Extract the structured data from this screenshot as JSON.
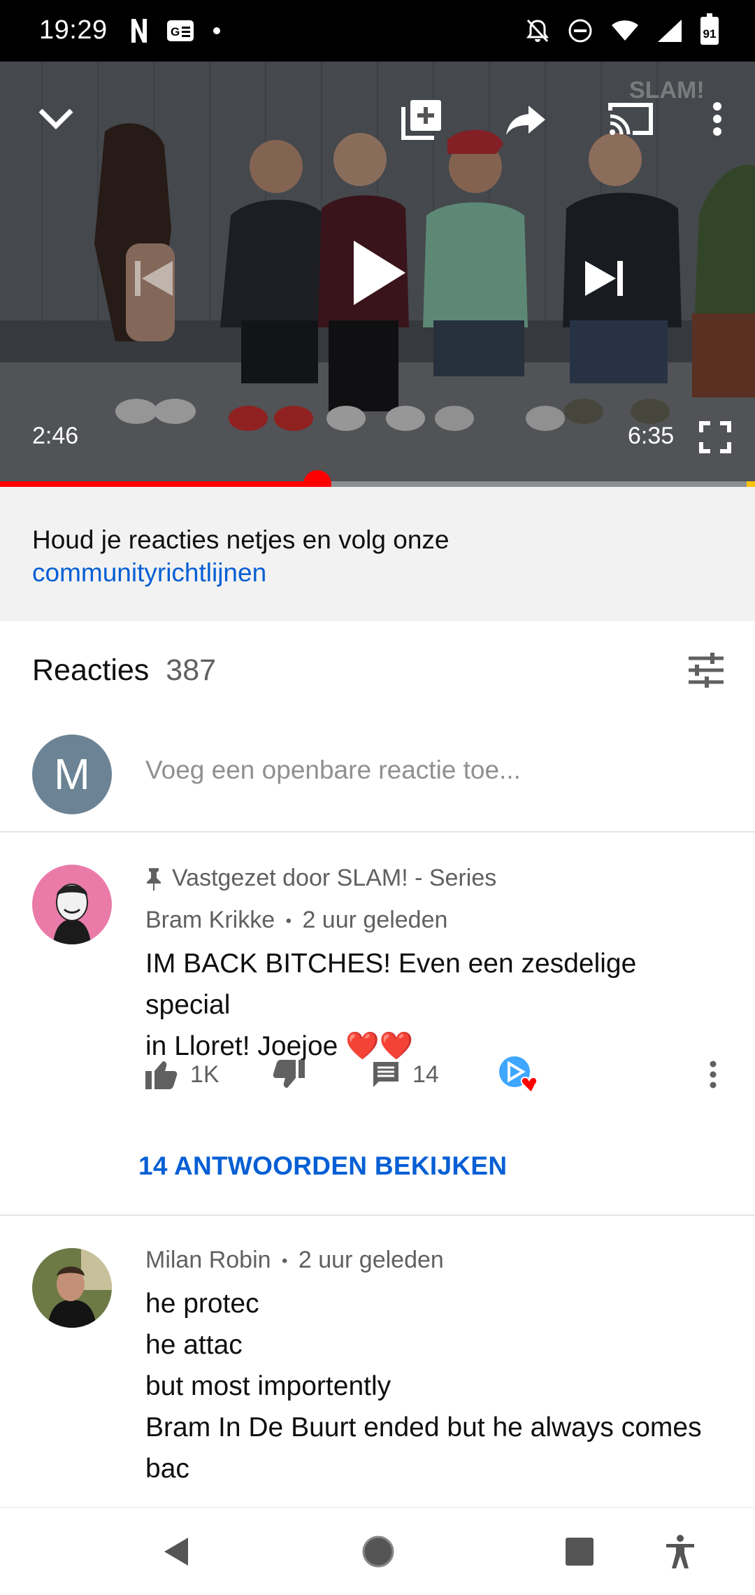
{
  "status_bar": {
    "time": "19:29",
    "battery": "91",
    "left_icons": [
      "netflix-icon",
      "news-icon",
      "dot-icon"
    ],
    "right_icons": [
      "bell-off-icon",
      "do-not-disturb-icon",
      "wifi-icon",
      "signal-icon",
      "battery-icon"
    ]
  },
  "player": {
    "current_time": "2:46",
    "duration": "6:35",
    "progress_fraction": 0.42,
    "controls": [
      "collapse-icon",
      "add-to-playlist-icon",
      "share-icon",
      "cast-icon",
      "more-icon",
      "previous-icon",
      "play-icon",
      "next-icon",
      "fullscreen-icon"
    ],
    "watermark": "SLAM!"
  },
  "guidelines": {
    "text": "Houd je reacties netjes en volg onze",
    "link": "communityrichtlijnen"
  },
  "comments": {
    "title": "Reacties",
    "count": "387",
    "add_placeholder": "Voeg een openbare reactie toe...",
    "user_initial": "M",
    "threads": [
      {
        "pinned_label": "Vastgezet door SLAM! - Series",
        "author": "Bram Krikke",
        "separator": "•",
        "time": "2 uur geleden",
        "text_lines": [
          "IM BACK BITCHES! Even een zesdelige special",
          "in Lloret! Joejoe ❤️❤️"
        ],
        "likes": "1K",
        "replies_count": "14",
        "replies_link": "14 ANTWOORDEN BEKIJKEN"
      },
      {
        "author": "Milan Robin",
        "separator": "•",
        "time": "2 uur geleden",
        "text_lines": [
          "he protec",
          "he attac",
          "but most importently",
          "Bram In De Buurt ended but he always comes",
          "bac"
        ]
      }
    ]
  },
  "colors": {
    "accent_red": "#ff0000",
    "link_blue": "#065fd4",
    "muted_text": "#606060",
    "avatar_m": "#6b8394",
    "creator_badge": "#3ea6ff"
  }
}
